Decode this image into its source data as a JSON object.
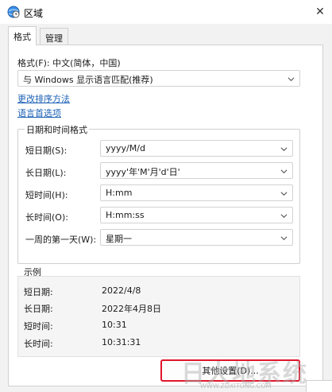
{
  "window": {
    "title": "区域"
  },
  "tabs": [
    {
      "label": "格式"
    },
    {
      "label": "管理"
    }
  ],
  "format": {
    "label": "格式(F): 中文(简体，中国)",
    "selected": "与 Windows 显示语言匹配(推荐)"
  },
  "links": {
    "sort": "更改排序方法",
    "language": "语言首选项"
  },
  "datetime": {
    "group_title": "日期和时间格式",
    "rows": [
      {
        "label": "短日期(S):",
        "value": "yyyy/M/d"
      },
      {
        "label": "长日期(L):",
        "value": "yyyy'年'M'月'd'日'"
      },
      {
        "label": "短时间(H):",
        "value": "H:mm"
      },
      {
        "label": "长时间(O):",
        "value": "H:mm:ss"
      },
      {
        "label": "一周的第一天(W):",
        "value": "星期一"
      }
    ]
  },
  "examples": {
    "group_title": "示例",
    "rows": [
      {
        "label": "短日期:",
        "value": "2022/4/8"
      },
      {
        "label": "长日期:",
        "value": "2022年4月8日"
      },
      {
        "label": "短时间:",
        "value": "10:31"
      },
      {
        "label": "长时间:",
        "value": "10:31:31"
      }
    ]
  },
  "buttons": {
    "additional_settings": "其他设置(D)..."
  },
  "watermark": {
    "text": "日大地系统",
    "sub": "WWW.ZDXITONG.COM"
  },
  "colors": {
    "accent": "#1a5fb4",
    "highlight": "#e0162b"
  },
  "icons": {
    "app": "globe-clock-icon",
    "close": "close-icon",
    "dropdown": "chevron-down-icon"
  }
}
